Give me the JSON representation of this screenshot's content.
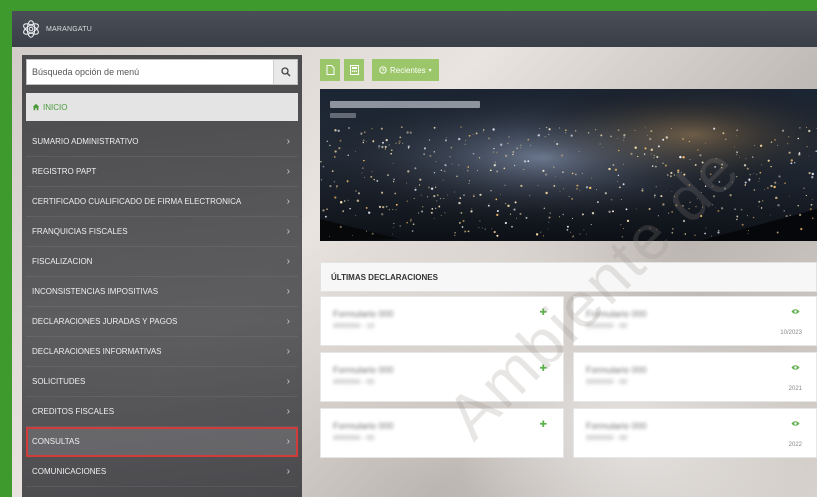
{
  "topbar": {
    "brand": "MARANGATU"
  },
  "sidebar": {
    "search_placeholder": "Búsqueda opción de menú",
    "inicio_label": "INICIO",
    "items": [
      {
        "label": "SUMARIO ADMINISTRATIVO"
      },
      {
        "label": "REGISTRO PAPT"
      },
      {
        "label": "CERTIFICADO CUALIFICADO DE FIRMA ELECTRONICA"
      },
      {
        "label": "FRANQUICIAS FISCALES"
      },
      {
        "label": "FISCALIZACION"
      },
      {
        "label": "INCONSISTENCIAS IMPOSITIVAS"
      },
      {
        "label": "DECLARACIONES JURADAS Y PAGOS"
      },
      {
        "label": "DECLARACIONES INFORMATIVAS"
      },
      {
        "label": "SOLICITUDES"
      },
      {
        "label": "CREDITOS FISCALES"
      },
      {
        "label": "CONSULTAS",
        "highlighted": true
      },
      {
        "label": "COMUNICACIONES"
      }
    ]
  },
  "toolbar": {
    "icons": [
      "document-icon",
      "calculator-icon"
    ],
    "recent_label": "Recientes"
  },
  "declarations": {
    "header": "ÚLTIMAS DECLARACIONES",
    "cards": [
      {
        "title": "Formulario 000",
        "subtitle": "0000000 - 10",
        "icon": "plus-icon",
        "period": ""
      },
      {
        "title": "Formulario 000",
        "subtitle": "0000000 - 00",
        "icon": "eye-icon",
        "period": "10/2023"
      },
      {
        "title": "Formulario 000",
        "subtitle": "0000000 - 00",
        "icon": "plus-icon",
        "period": ""
      },
      {
        "title": "Formulario 000",
        "subtitle": "0000000 - 00",
        "icon": "eye-icon",
        "period": "2021"
      },
      {
        "title": "Formulario 000",
        "subtitle": "0000000 - 00",
        "icon": "plus-icon",
        "period": ""
      },
      {
        "title": "Formulario 000",
        "subtitle": "0000000 - 00",
        "icon": "eye-icon",
        "period": "2022"
      }
    ]
  },
  "watermark": "Ambiente de",
  "colors": {
    "accent_green": "#4a9a3b",
    "button_green": "#9bc66a",
    "highlight_red": "#d33a3a"
  }
}
